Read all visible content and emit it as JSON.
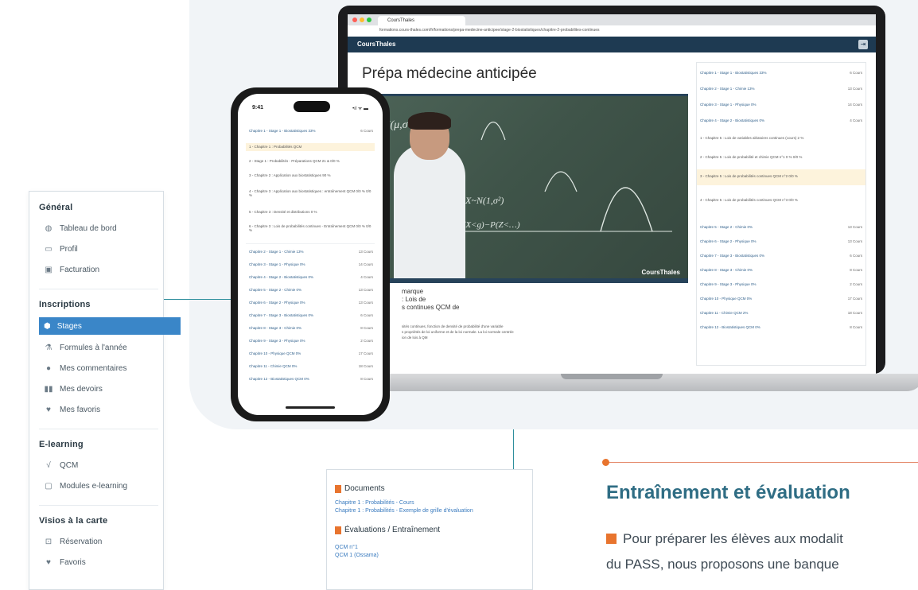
{
  "sidebar": {
    "sections": [
      {
        "title": "Général",
        "items": [
          {
            "label": "Tableau de bord",
            "icon": "dashboard-icon"
          },
          {
            "label": "Profil",
            "icon": "id-card-icon"
          },
          {
            "label": "Facturation",
            "icon": "billing-icon"
          }
        ]
      },
      {
        "title": "Inscriptions",
        "items": [
          {
            "label": "Stages",
            "icon": "stages-icon",
            "active": true
          },
          {
            "label": "Formules à l'année",
            "icon": "formula-icon"
          },
          {
            "label": "Mes commentaires",
            "icon": "comment-icon"
          },
          {
            "label": "Mes devoirs",
            "icon": "book-icon"
          },
          {
            "label": "Mes favoris",
            "icon": "heart-icon"
          }
        ]
      },
      {
        "title": "E-learning",
        "items": [
          {
            "label": "QCM",
            "icon": "sqrt-icon"
          },
          {
            "label": "Modules e-learning",
            "icon": "module-icon"
          }
        ]
      },
      {
        "title": "Visios à la carte",
        "items": [
          {
            "label": "Réservation",
            "icon": "reservation-icon"
          },
          {
            "label": "Favoris",
            "icon": "heart-icon"
          }
        ]
      }
    ],
    "active_color": "#3a86c8"
  },
  "laptop": {
    "browser_tab": "CoursThales",
    "url": "formations.cours-thales.com/fr/formations/prepa-medecine-anticipee/stage-2-biostatistiques/chapitre-2-probabilites-continues",
    "app_title": "CoursThales",
    "page_title": "Prépa médecine anticipée",
    "video_watermark": "CoursThales",
    "course_lines": [
      "marque",
      ": Lois de",
      "s continues QCM de"
    ],
    "course_desc": [
      "sités continues, fonction de densité de probabilité d'une variable",
      "s propriétés de loi uniforme et de la loi normale. La loi normale centrée",
      "ion de lois à QM"
    ],
    "chapters": [
      {
        "label": "Chapitre 1 - Stage 1 - Biostatistiques 33%",
        "count": "6 Cours"
      },
      {
        "label": "Chapitre 2 - Stage 1 - Chimie 13%",
        "count": "13 Cours"
      },
      {
        "label": "Chapitre 3 - Stage 1 - Physique 0%",
        "count": "14 Cours"
      },
      {
        "label": "Chapitre 4 - Stage 2 - Biostatistiques 0%",
        "count": "4 Cours"
      }
    ],
    "chapter_subs": [
      "1 - Chapitre 5 : Lois de variables aléatoires continues (cours) 2 %",
      "2 - Chapitre 5 : Lois de probabilité et chimie QCM n°1 0 % 0/0 %",
      "3 - Chapitre 5 : Lois de probabilités continues QCM n°2 0/0 %",
      "4 - Chapitre 5 : Lois de probabilités continues QCM n°3 0/0 %"
    ],
    "chapters_b": [
      {
        "label": "Chapitre 5 - Stage 2 - Chimie 0%",
        "count": "13 Cours"
      },
      {
        "label": "Chapitre 6 - Stage 2 - Physique 0%",
        "count": "13 Cours"
      },
      {
        "label": "Chapitre 7 - Stage 3 - Biostatistiques 0%",
        "count": "6 Cours"
      },
      {
        "label": "Chapitre 8 - Stage 3 - Chimie 0%",
        "count": "8 Cours"
      },
      {
        "label": "Chapitre 9 - Stage 3 - Physique 0%",
        "count": "2 Cours"
      },
      {
        "label": "Chapitre 10 - Physique QCM 0%",
        "count": "17 Cours"
      },
      {
        "label": "Chapitre 11 - Chimie QCM 2%",
        "count": "18 Cours"
      },
      {
        "label": "Chapitre 12 - Biostatistiques QCM 0%",
        "count": "8 Cours"
      }
    ]
  },
  "phone": {
    "time": "9:41",
    "status": "•ıl ᯤ ▬",
    "top_row": {
      "label": "Chapitre 1 - Stage 1 - Biostatistiques 33%",
      "count": "6 Cours"
    },
    "subs": [
      "1 - Chapitre 1 : Probabilités QCM",
      "2 - Stage 1 : Probabilités - Préparations QCM 21 & 0/0 %",
      "3 - Chapitre 2 : Application aux biostatistiques 90 %",
      "4 - Chapitre 3 : Application aux biostatistiques : entraînement QCM 0/0 % 0/0 %",
      "5 - Chapitre 3 : Densité et distributions 0 %",
      "6 - Chapitre 3 : Lois de probabilités continues - Entraînement QCM 0/0 % 0/0 %"
    ],
    "rows": [
      {
        "label": "Chapitre 2 - Stage 1 - Chimie 13%",
        "count": "13 Cours"
      },
      {
        "label": "Chapitre 3 - Stage 1 - Physique 0%",
        "count": "14 Cours"
      },
      {
        "label": "Chapitre 4 - Stage 2 - Biostatistiques 0%",
        "count": "4 Cours"
      },
      {
        "label": "Chapitre 5 - Stage 2 - Chimie 0%",
        "count": "13 Cours"
      },
      {
        "label": "Chapitre 6 - Stage 2 - Physique 0%",
        "count": "13 Cours"
      },
      {
        "label": "Chapitre 7 - Stage 3 - Biostatistiques 0%",
        "count": "6 Cours"
      },
      {
        "label": "Chapitre 8 - Stage 3 - Chimie 0%",
        "count": "8 Cours"
      },
      {
        "label": "Chapitre 9 - Stage 3 - Physique 0%",
        "count": "2 Cours"
      },
      {
        "label": "Chapitre 10 - Physique QCM 0%",
        "count": "17 Cours"
      },
      {
        "label": "Chapitre 11 - Chimie QCM 0%",
        "count": "18 Cours"
      },
      {
        "label": "Chapitre 12 - Biostatistiques QCM 0%",
        "count": "8 Cours"
      }
    ]
  },
  "documents_card": {
    "documents_title": "Documents",
    "documents": [
      "Chapitre 1 : Probabilités - Cours",
      "Chapitre 1 : Probabilités - Exemple de grille d'évaluation"
    ],
    "evaluations_title": "Évaluations / Entraînement",
    "evaluations": [
      "QCM n°1",
      "QCM 1 (Ossama)"
    ]
  },
  "right": {
    "title": "Entraînement et évaluation",
    "body_line_1": "Pour préparer les élèves aux modalit",
    "body_line_2": "du PASS, nous proposons une banque",
    "accent": "#e8742e",
    "title_color": "#2f6d84"
  }
}
